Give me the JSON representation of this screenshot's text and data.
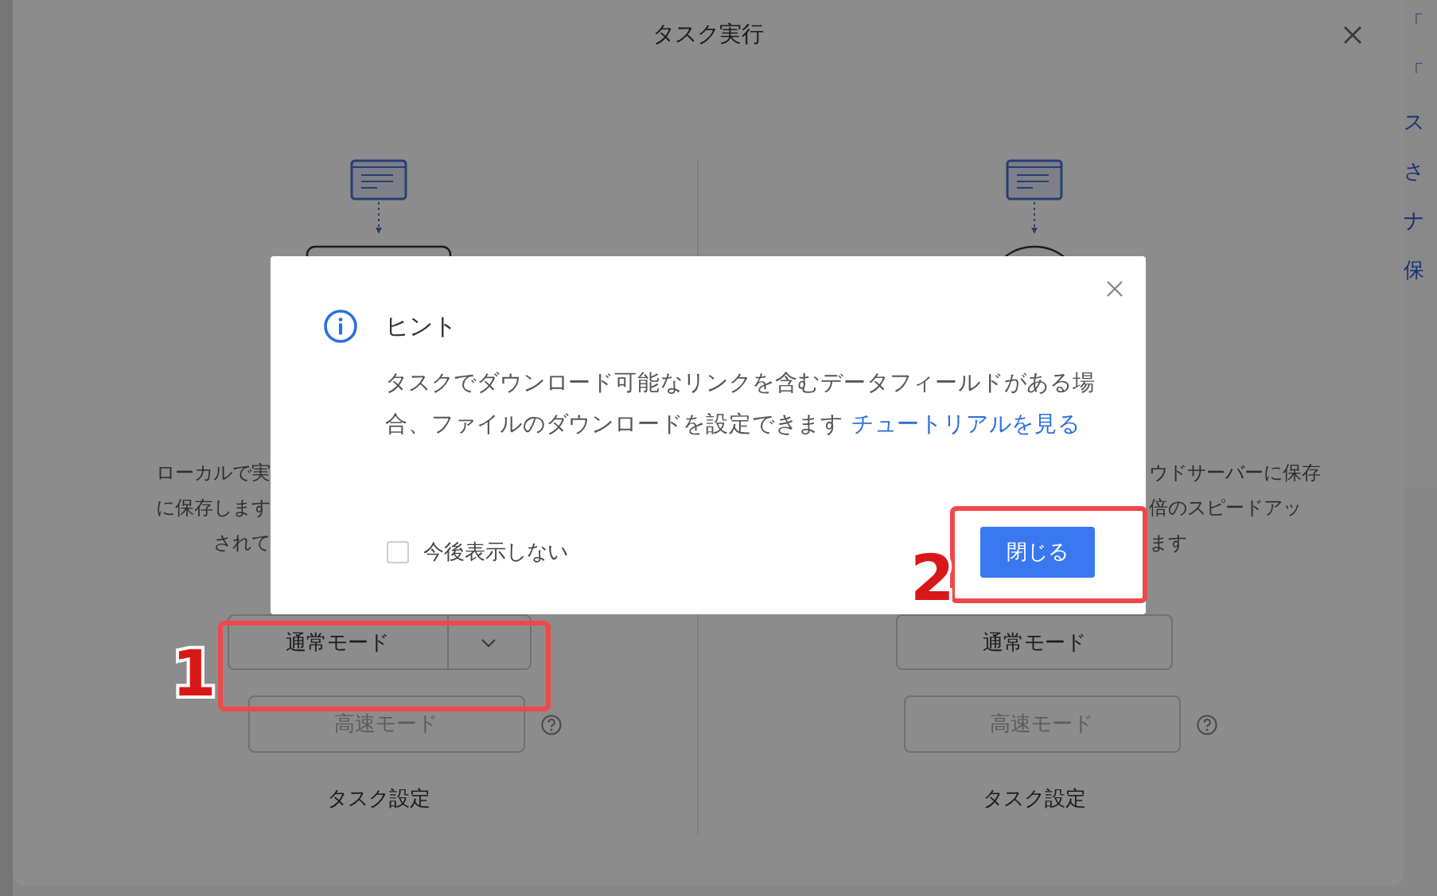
{
  "background_page": {
    "right_fragments": [
      "「",
      "「",
      "ス",
      "さ",
      "ナ",
      "保"
    ]
  },
  "task_dialog": {
    "title": "タスク実行",
    "columns": [
      {
        "kind": "rect",
        "description_lines": [
          "ローカルで実",
          "に保存します",
          "されて"
        ],
        "mode_button": {
          "label": "通常モード",
          "dropdown": true
        },
        "fast_button": {
          "label": "高速モード",
          "disabled": true
        },
        "footer": "タスク設定"
      },
      {
        "kind": "circle",
        "description_lines": [
          "ウドサーバーに保存",
          "倍のスピードアッ",
          "ます"
        ],
        "mode_button": {
          "label": "通常モード",
          "dropdown": false
        },
        "fast_button": {
          "label": "高速モード",
          "disabled": true
        },
        "footer": "タスク設定"
      }
    ]
  },
  "hint_dialog": {
    "title": "ヒント",
    "message": "タスクでダウンロード可能なリンクを含むデータフィールドがある場合、ファイルのダウンロードを設定できます",
    "link": "チュートリアルを見る",
    "checkbox": {
      "label": "今後表示しない",
      "checked": false
    },
    "button": "閉じる"
  },
  "annotations": [
    {
      "number": "1"
    },
    {
      "number": "2"
    }
  ]
}
